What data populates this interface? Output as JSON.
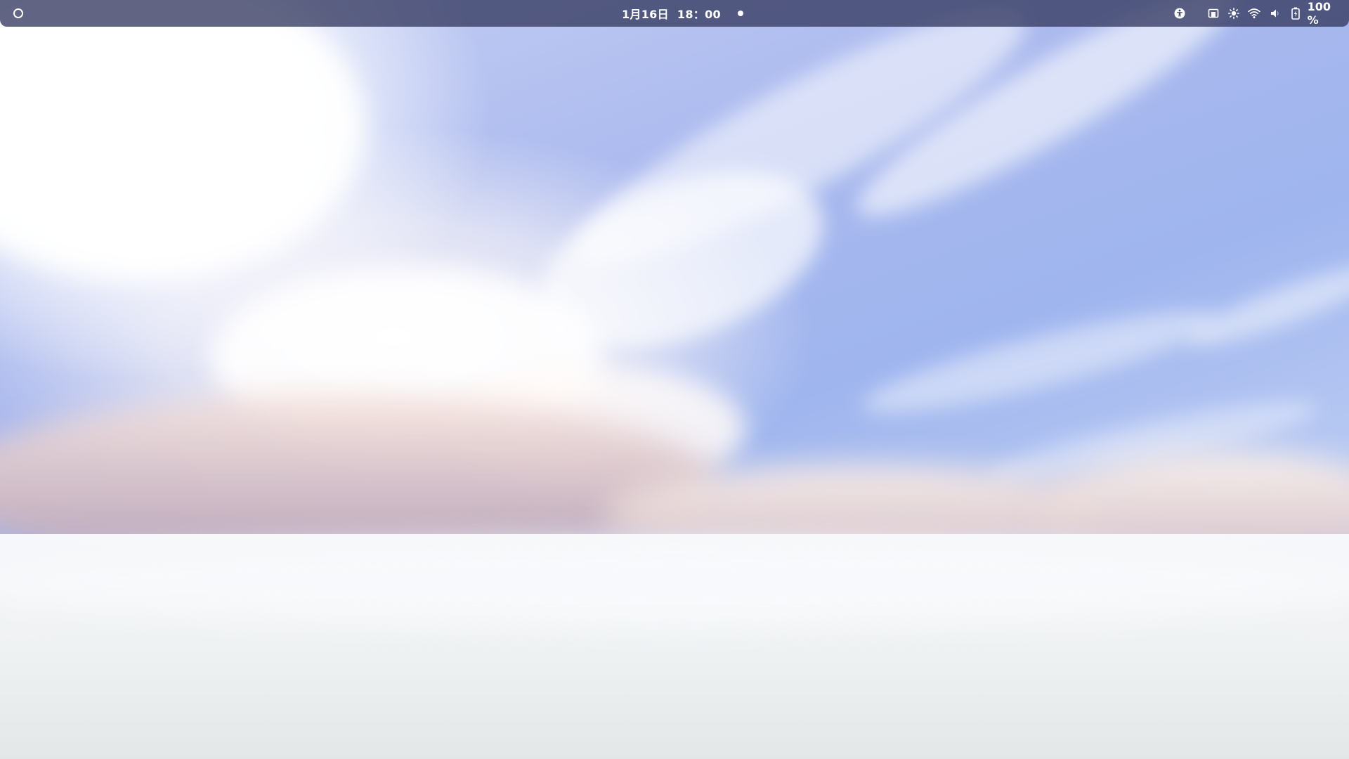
{
  "topbar": {
    "activities_icon": "activities-circle-icon",
    "clock": {
      "date": "1月16日",
      "time": "18：00"
    },
    "notification_indicator": "notification-dot",
    "accessibility_icon": "accessibility-icon",
    "status": {
      "icons": [
        "screen-share-icon",
        "brightness-icon",
        "wifi-icon",
        "volume-icon",
        "battery-icon"
      ],
      "battery_percent": "100 %"
    }
  },
  "colors": {
    "topbar_bg": "#343a60",
    "sky_blue": "#a9b8ee",
    "cloud_white": "#ffffff",
    "cloud_shadow_mauve": "#b9a3b1"
  }
}
